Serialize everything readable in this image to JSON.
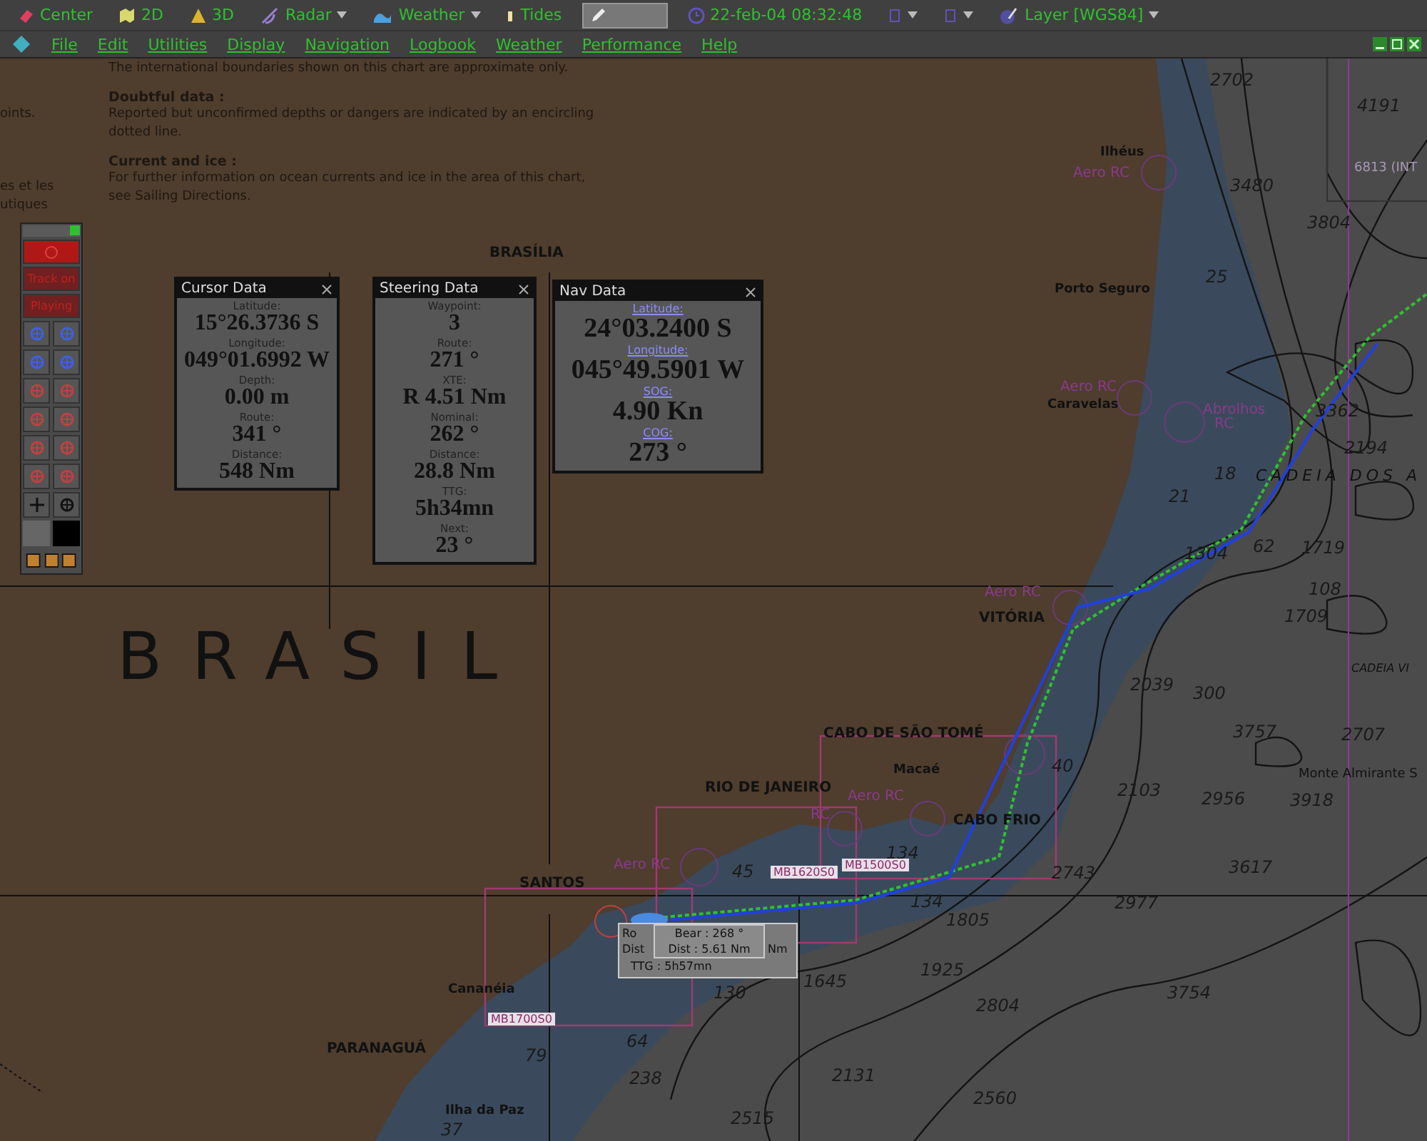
{
  "toolbar": {
    "items": [
      {
        "kind": "button",
        "label": "Center",
        "selected": false
      },
      {
        "kind": "button",
        "label": "2D",
        "selected": false
      },
      {
        "kind": "button",
        "label": "3D",
        "selected": false
      },
      {
        "kind": "dropdown",
        "label": "Radar",
        "selected": false
      },
      {
        "kind": "dropdown",
        "label": "Weather",
        "selected": false
      },
      {
        "kind": "button",
        "label": "Tides",
        "selected": false
      },
      {
        "kind": "tool",
        "selected": true
      },
      {
        "kind": "clock",
        "label": "22-feb-04 08:32:48",
        "selected": false
      },
      {
        "kind": "icon-dropdown",
        "selected": false
      },
      {
        "kind": "icon-dropdown",
        "selected": false
      },
      {
        "kind": "dropdown",
        "label": "Layer [WGS84]",
        "selected": false
      }
    ]
  },
  "menu": [
    "File",
    "Edit",
    "Utilities",
    "Display",
    "Navigation",
    "Logbook",
    "Weather",
    "Performance",
    "Help"
  ],
  "chart_notes": {
    "fragments": [
      "oints.",
      "es et les",
      "utiques"
    ],
    "intro": "The international boundaries shown on this chart are approximate only.",
    "sections": [
      {
        "heading": "Doubtful data :",
        "body": "Reported but unconfirmed depths or dangers are indicated by an encircling dotted line."
      },
      {
        "heading": "Current and ice :",
        "body": "For further information on ocean currents and ice in the area of this chart, see Sailing Directions."
      }
    ]
  },
  "map_labels": [
    {
      "kind": "country",
      "text": "BRASIL"
    },
    {
      "kind": "city",
      "text": "BRASÍLIA"
    },
    {
      "kind": "town",
      "text": "Ilhéus"
    },
    {
      "kind": "radio",
      "text": "Aero RC"
    },
    {
      "kind": "town",
      "text": "Porto Seguro"
    },
    {
      "kind": "radio",
      "text": "Aero RC"
    },
    {
      "kind": "town",
      "text": "Caravelas"
    },
    {
      "kind": "radio",
      "text": "Abrolhos"
    },
    {
      "kind": "radio",
      "text": "RC"
    },
    {
      "kind": "radio",
      "text": "Aero RC"
    },
    {
      "kind": "city",
      "text": "VITÓRIA"
    },
    {
      "kind": "city",
      "text": "CABO DE SÃO TOMÉ"
    },
    {
      "kind": "town",
      "text": "Macaé"
    },
    {
      "kind": "city",
      "text": "RIO DE JANEIRO"
    },
    {
      "kind": "radio",
      "text": "Aero RC"
    },
    {
      "kind": "radio",
      "text": "RC"
    },
    {
      "kind": "city",
      "text": "CABO FRIO"
    },
    {
      "kind": "radio",
      "text": "Aero RC"
    },
    {
      "kind": "city",
      "text": "SANTOS"
    },
    {
      "kind": "town",
      "text": "Cananéia"
    },
    {
      "kind": "city",
      "text": "PARANAGUÁ"
    },
    {
      "kind": "town",
      "text": "Ilha da Paz"
    },
    {
      "kind": "depth",
      "text": "2702"
    },
    {
      "kind": "depth",
      "text": "4191"
    },
    {
      "kind": "depth",
      "text": "3480"
    },
    {
      "kind": "depth",
      "text": "3804"
    },
    {
      "kind": "depth",
      "text": "25"
    },
    {
      "kind": "depth",
      "text": "3362"
    },
    {
      "kind": "depth",
      "text": "2194"
    },
    {
      "kind": "depth",
      "text": "18"
    },
    {
      "kind": "depth",
      "text": "21"
    },
    {
      "kind": "depth",
      "text": "1304"
    },
    {
      "kind": "depth",
      "text": "62"
    },
    {
      "kind": "depth",
      "text": "1719"
    },
    {
      "kind": "depth",
      "text": "108"
    },
    {
      "kind": "depth",
      "text": "1709"
    },
    {
      "kind": "depth",
      "text": "2039"
    },
    {
      "kind": "depth",
      "text": "300"
    },
    {
      "kind": "depth",
      "text": "3757"
    },
    {
      "kind": "depth",
      "text": "2707"
    },
    {
      "kind": "depth",
      "text": "2103"
    },
    {
      "kind": "depth",
      "text": "2956"
    },
    {
      "kind": "depth",
      "text": "3918"
    },
    {
      "kind": "depth",
      "text": "3617"
    },
    {
      "kind": "depth",
      "text": "2743"
    },
    {
      "kind": "depth",
      "text": "2977"
    },
    {
      "kind": "depth",
      "text": "134"
    },
    {
      "kind": "depth",
      "text": "134"
    },
    {
      "kind": "depth",
      "text": "45"
    },
    {
      "kind": "depth",
      "text": "40"
    },
    {
      "kind": "depth",
      "text": "1805"
    },
    {
      "kind": "depth",
      "text": "1925"
    },
    {
      "kind": "depth",
      "text": "1645"
    },
    {
      "kind": "depth",
      "text": "2804"
    },
    {
      "kind": "depth",
      "text": "3754"
    },
    {
      "kind": "depth",
      "text": "64"
    },
    {
      "kind": "depth",
      "text": "79"
    },
    {
      "kind": "depth",
      "text": "238"
    },
    {
      "kind": "depth",
      "text": "130"
    },
    {
      "kind": "depth",
      "text": "2131"
    },
    {
      "kind": "depth",
      "text": "2560"
    },
    {
      "kind": "depth",
      "text": "2515"
    },
    {
      "kind": "depth",
      "text": "37"
    },
    {
      "kind": "limit",
      "text": "6813 (INT"
    },
    {
      "kind": "region",
      "text": "CADEIA DOS A"
    },
    {
      "kind": "region",
      "text": "CADEIA VI"
    },
    {
      "kind": "feature",
      "text": "Monte Almirante S"
    },
    {
      "kind": "chart-id",
      "text": "MB1620S0"
    },
    {
      "kind": "chart-id",
      "text": "MB1500S0"
    },
    {
      "kind": "chart-id",
      "text": "MB1700S0"
    }
  ],
  "tool_palette": {
    "buttons": [
      "Track on",
      "Playing"
    ]
  },
  "panels": [
    {
      "kind": "plain",
      "title": "Cursor Data",
      "fields": [
        {
          "label": "Latitude:",
          "value": "15°26.3736 S"
        },
        {
          "label": "Longitude:",
          "value": "049°01.6992 W"
        },
        {
          "label": "Depth:",
          "value": "0.00 m"
        },
        {
          "label": "Route:",
          "value": "341 °"
        },
        {
          "label": "Distance:",
          "value": "548 Nm"
        }
      ]
    },
    {
      "kind": "plain",
      "title": "Steering Data",
      "fields": [
        {
          "label": "Waypoint:",
          "value": "3"
        },
        {
          "label": "Route:",
          "value": "271 °"
        },
        {
          "label": "XTE:",
          "value": "R 4.51 Nm"
        },
        {
          "label": "Nominal:",
          "value": "262 °"
        },
        {
          "label": "Distance:",
          "value": "28.8 Nm"
        },
        {
          "label": "TTG:",
          "value": "5h34mn"
        },
        {
          "label": "Next:",
          "value": "23 °"
        }
      ]
    },
    {
      "kind": "linked",
      "title": "Nav Data",
      "fields": [
        {
          "label": "Latitude:",
          "value": "24°03.2400 S"
        },
        {
          "label": "Longitude:",
          "value": "045°49.5901 W"
        },
        {
          "label": "SOG:",
          "value": "4.90 Kn"
        },
        {
          "label": "COG:",
          "value": "273 °"
        }
      ]
    }
  ],
  "route_popup": {
    "back_lines": [
      "Ro",
      "Dist",
      "Nm",
      "TTG : 5h57mn"
    ],
    "front_lines": [
      "Bear : 268 °",
      "Dist : 5.61 Nm"
    ]
  }
}
